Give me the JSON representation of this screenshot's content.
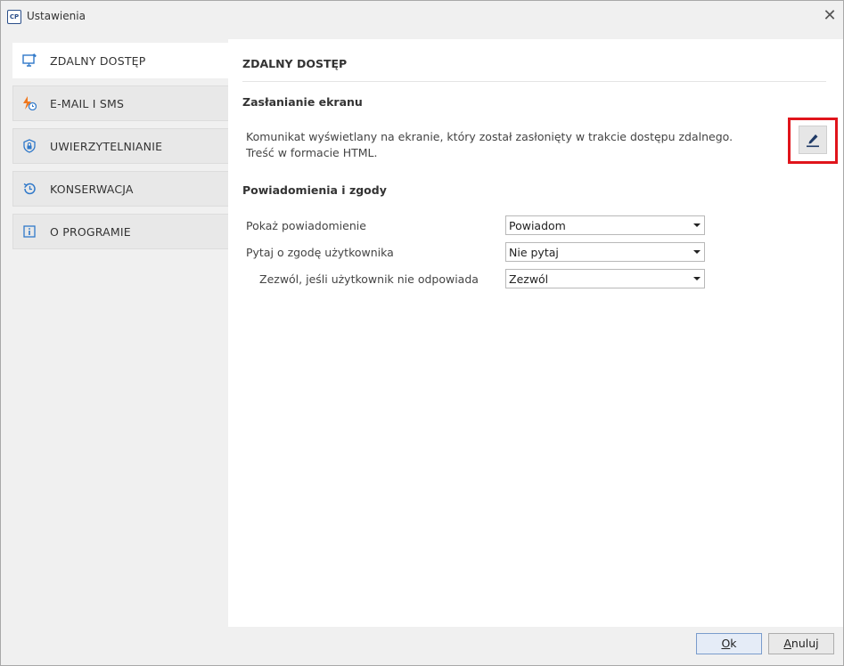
{
  "window": {
    "app_icon_text": "CP",
    "title": "Ustawienia",
    "close_glyph": "✕"
  },
  "sidebar": {
    "items": [
      {
        "label": "ZDALNY DOSTĘP",
        "icon": "monitor-icon",
        "active": true
      },
      {
        "label": "E-MAIL I SMS",
        "icon": "lightning-clock-icon",
        "active": false
      },
      {
        "label": "UWIERZYTELNIANIE",
        "icon": "shield-lock-icon",
        "active": false
      },
      {
        "label": "KONSERWACJA",
        "icon": "history-icon",
        "active": false
      },
      {
        "label": "O PROGRAMIE",
        "icon": "info-icon",
        "active": false
      }
    ]
  },
  "content": {
    "section_title": "ZDALNY DOSTĘP",
    "screen_cover": {
      "heading": "Zasłanianie ekranu",
      "description": "Komunikat wyświetlany na ekranie, który został zasłonięty w trakcie dostępu zdalnego. Treść w formacie HTML.",
      "edit_icon": "pen-icon",
      "highlight_color": "#e0141b"
    },
    "notifications": {
      "heading": "Powiadomienia i zgody",
      "rows": [
        {
          "label": "Pokaż powiadomienie",
          "value": "Powiadom"
        },
        {
          "label": "Pytaj o zgodę użytkownika",
          "value": "Nie pytaj"
        },
        {
          "label": "Zezwól, jeśli użytkownik nie odpowiada",
          "value": "Zezwól"
        }
      ]
    }
  },
  "footer": {
    "ok": {
      "first": "O",
      "rest": "k"
    },
    "cancel": {
      "first": "A",
      "rest": "nuluj"
    }
  },
  "colors": {
    "accent": "#2f78c9",
    "active_bg": "#ffffff",
    "inactive_bg": "#e8e8e8"
  }
}
